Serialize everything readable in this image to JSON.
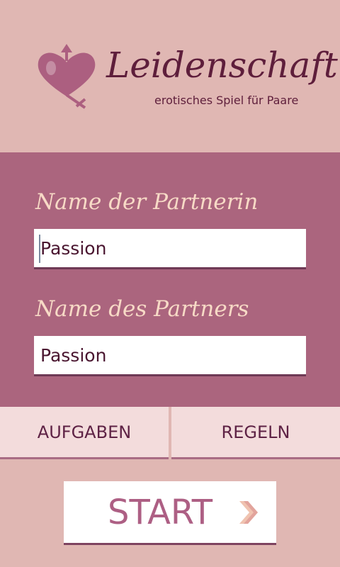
{
  "logo": {
    "icon": "heart-gender-symbol-icon",
    "title": "Leidenschaft",
    "subtitle": "erotisches Spiel für Paare"
  },
  "form": {
    "partner_female": {
      "label": "Name der Partnerin",
      "value": "Passion"
    },
    "partner_male": {
      "label": "Name des Partners",
      "value": "Passion"
    }
  },
  "buttons": {
    "tasks_label": "AUFGABEN",
    "rules_label": "REGELN",
    "start_label": "START",
    "start_icon": "chevron-right-icon"
  },
  "colors": {
    "background": "#e0b7b3",
    "panel": "#ab657e",
    "label": "#f7dac6",
    "brand_dark": "#5e1e3b",
    "button": "#f3dcdc",
    "start_text": "#ad5f84"
  }
}
